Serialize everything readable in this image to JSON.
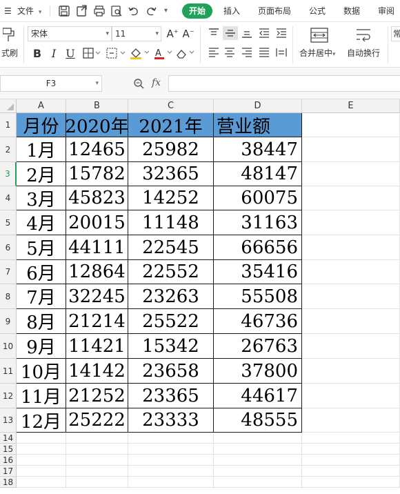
{
  "menubar": {
    "menu_label": "文件",
    "tabs": [
      {
        "label": "开始",
        "active": true
      },
      {
        "label": "插入",
        "active": false
      },
      {
        "label": "页面布局",
        "active": false
      },
      {
        "label": "公式",
        "active": false
      },
      {
        "label": "数据",
        "active": false
      },
      {
        "label": "审阅",
        "active": false
      }
    ],
    "quick_access_icons": [
      "save-icon",
      "export-icon",
      "print-icon",
      "print-preview-icon",
      "undo-icon",
      "redo-icon",
      "more-icon"
    ]
  },
  "ribbon": {
    "format_painter_label": "式刷",
    "font_name": "宋体",
    "font_size": "11",
    "merge_label": "合并居中",
    "wrap_label": "自动换行",
    "number_format_label": "常",
    "bold": "B",
    "italic": "I",
    "underline": "U",
    "font_color": "#e02020",
    "fill_color": "#f5c518"
  },
  "formula_bar": {
    "cell_ref": "F3",
    "fx": "fx",
    "formula": ""
  },
  "sheet": {
    "columns": [
      "A",
      "B",
      "C",
      "D",
      "E"
    ],
    "rows": [
      "1",
      "2",
      "3",
      "4",
      "5",
      "6",
      "7",
      "8",
      "9",
      "10",
      "11",
      "12",
      "13",
      "14",
      "15",
      "16",
      "17",
      "18"
    ],
    "active_row": "3",
    "header_fill": "#5b9bd5",
    "headers": [
      "月份",
      "2020年",
      "2021年",
      "营业额"
    ],
    "data": [
      [
        "1月",
        "12465",
        "25982",
        "38447"
      ],
      [
        "2月",
        "15782",
        "32365",
        "48147"
      ],
      [
        "3月",
        "45823",
        "14252",
        "60075"
      ],
      [
        "4月",
        "20015",
        "11148",
        "31163"
      ],
      [
        "5月",
        "44111",
        "22545",
        "66656"
      ],
      [
        "6月",
        "12864",
        "22552",
        "35416"
      ],
      [
        "7月",
        "32245",
        "23263",
        "55508"
      ],
      [
        "8月",
        "21214",
        "25522",
        "46736"
      ],
      [
        "9月",
        "11421",
        "15342",
        "26763"
      ],
      [
        "10月",
        "14142",
        "23658",
        "37800"
      ],
      [
        "11月",
        "21252",
        "23365",
        "44617"
      ],
      [
        "12月",
        "25222",
        "23333",
        "48555"
      ]
    ]
  }
}
